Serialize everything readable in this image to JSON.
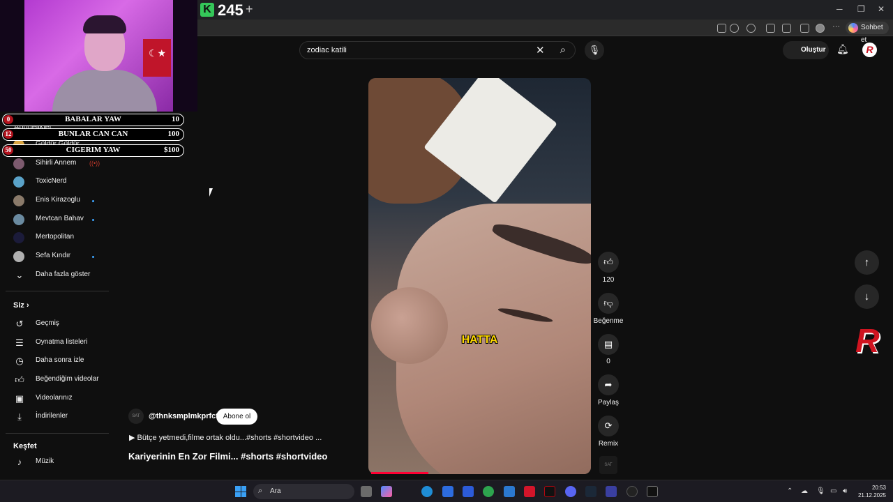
{
  "browser": {
    "tab_badge": "K",
    "tab_count": "245",
    "copilot_label": "Sohbet et"
  },
  "overlay": {
    "goals": [
      {
        "num": "0",
        "title": "BABALAR YAW",
        "value": "10"
      },
      {
        "num": "12",
        "title": "BUNLAR CAN CAN",
        "value": "100"
      },
      {
        "num": "50",
        "title": "CIGERIM YAW",
        "value": "$100"
      }
    ]
  },
  "sidebar": {
    "subscriptions_title": "Abonelikler",
    "subscriptions": [
      {
        "name": "Güldür Güldür",
        "color": "#d9a441",
        "indicator": "live"
      },
      {
        "name": "Sihirli Annem",
        "color": "#7c5a6e",
        "indicator": "live"
      },
      {
        "name": "ToxicNerd",
        "color": "#5aa2c8",
        "indicator": ""
      },
      {
        "name": "Enis Kirazoglu",
        "color": "#8a7a6a",
        "indicator": "dot"
      },
      {
        "name": "Mevtcan Bahav",
        "color": "#6a8aa0",
        "indicator": "dot"
      },
      {
        "name": "Mertopolitan",
        "color": "#1b1b3a",
        "indicator": ""
      },
      {
        "name": "Sefa Kındır",
        "color": "#b0b0b0",
        "indicator": "dot"
      }
    ],
    "show_more": "Daha fazla göster",
    "you_title": "Siz",
    "you_items": [
      {
        "label": "Geçmiş",
        "icon": "history-icon"
      },
      {
        "label": "Oynatma listeleri",
        "icon": "playlist-icon"
      },
      {
        "label": "Daha sonra izle",
        "icon": "clock-icon"
      },
      {
        "label": "Beğendiğim videolar",
        "icon": "thumbs-up-icon"
      },
      {
        "label": "Videolarınız",
        "icon": "video-icon"
      },
      {
        "label": "İndirilenler",
        "icon": "download-icon"
      }
    ],
    "explore_title": "Keşfet",
    "explore_items": [
      {
        "label": "Müzik",
        "icon": "music-icon"
      }
    ]
  },
  "header": {
    "search_value": "zodiac katili",
    "create_label": "Oluştur",
    "avatar_letter": "R"
  },
  "short": {
    "caption": "HATTA",
    "channel_handle": "@thnksmplmkprfct",
    "subscribe_label": "Abone ol",
    "description": "▶ Bütçe yetmedi,filme ortak oldu...#shorts #shortvideo ...",
    "title": "Kariyerinin En Zor Filmi... #shorts #shortvideo",
    "progress": 0.26,
    "likes": "120",
    "dislike_label": "Beğenme",
    "comments": "0",
    "share_label": "Paylaş",
    "remix_label": "Remix"
  },
  "taskbar": {
    "search_placeholder": "Ara",
    "time": "20:53",
    "date": "21.12.2025"
  },
  "colors": {
    "accent": "#ff0033",
    "brand_red": "#d01420"
  }
}
